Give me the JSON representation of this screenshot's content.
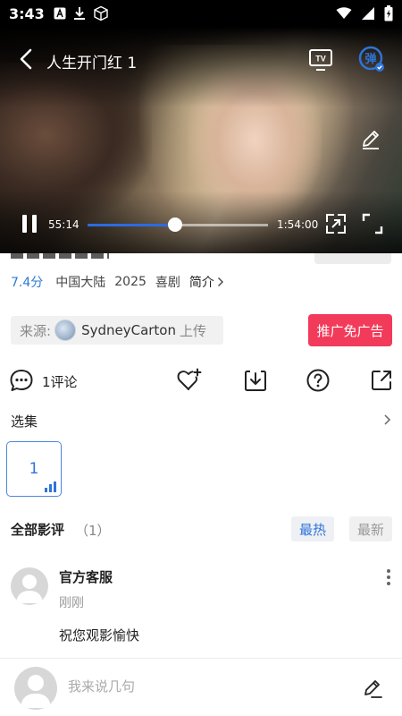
{
  "status_bar": {
    "time": "3:43",
    "left_icons": [
      "font-a-icon",
      "download-arrow-icon",
      "cube-icon"
    ],
    "right_icons": [
      "wifi-icon",
      "signal-icon",
      "battery-icon"
    ]
  },
  "player": {
    "title": "人生开门红 1",
    "current_time": "55:14",
    "total_time": "1:54:00",
    "progress": 0.485,
    "ai_badge_label": "弹"
  },
  "meta": {
    "score": "7.4分",
    "region": "中国大陆",
    "year": "2025",
    "genre": "喜剧",
    "intro_label": "简介"
  },
  "source": {
    "label": "来源:",
    "uploader": "SydneyCarton",
    "suffix": "上传"
  },
  "ad_button_label": "推广免广告",
  "actions": {
    "comment_count_label": "1评论"
  },
  "episodes": {
    "label": "选集",
    "items": [
      {
        "number": "1",
        "playing": true
      }
    ]
  },
  "reviews": {
    "title": "全部影评",
    "count": "（1）",
    "sort_hot": "最热",
    "sort_new": "最新",
    "items": [
      {
        "author": "官方客服",
        "time": "刚刚",
        "text": "祝您观影愉快"
      }
    ]
  },
  "comment_bar": {
    "placeholder": "我来说几句"
  },
  "colors": {
    "accent_blue": "#2e74d8",
    "ad_red": "#f23a5a",
    "score_blue": "#2e7ad6"
  }
}
